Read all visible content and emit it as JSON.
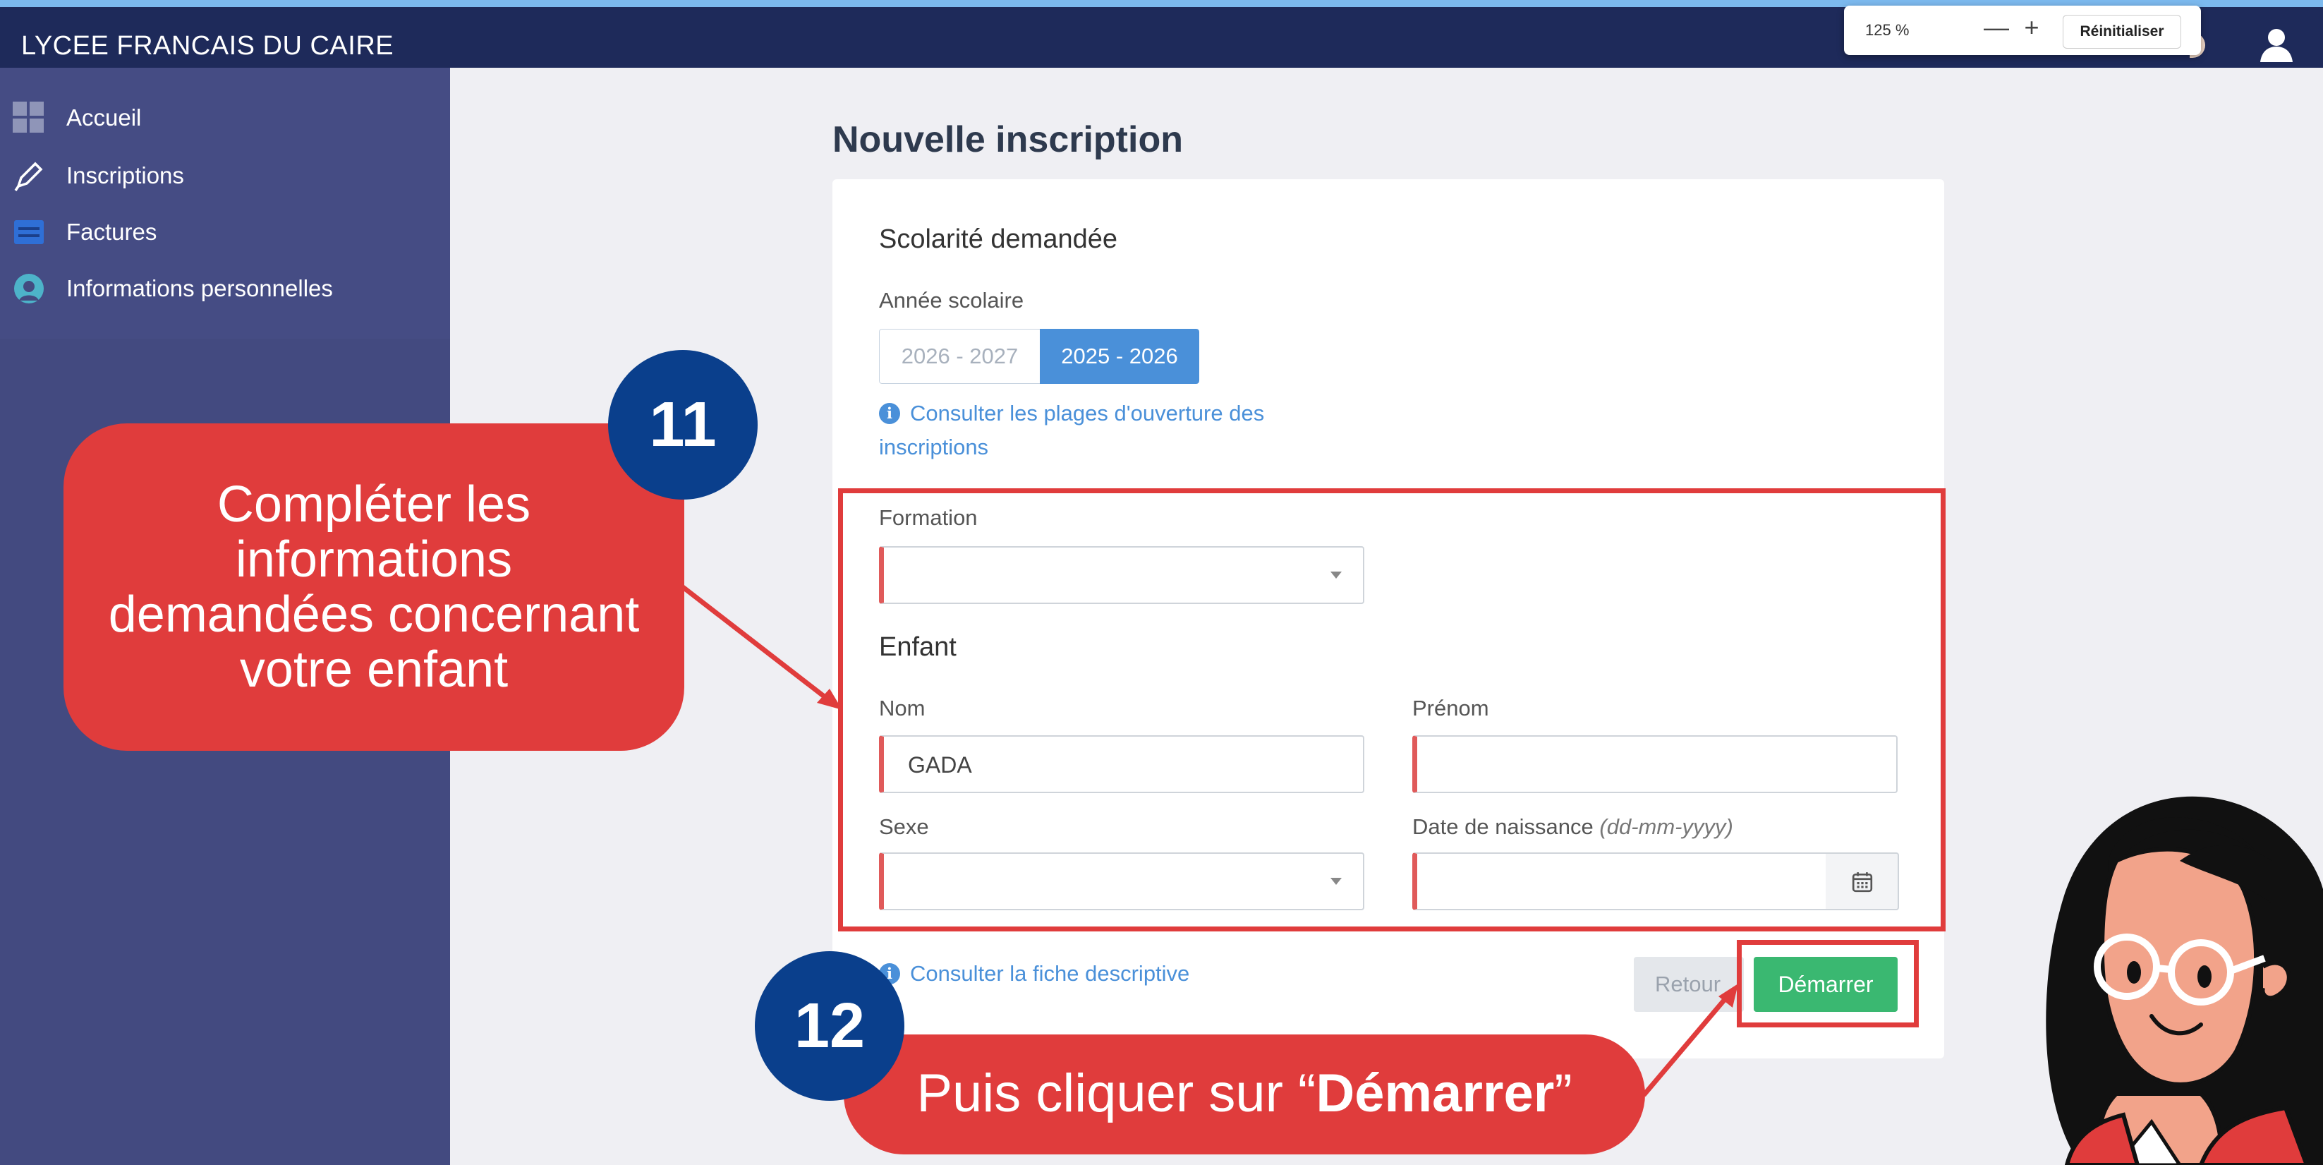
{
  "app": {
    "title": "LYCEE FRANCAIS DU CAIRE"
  },
  "zoom_popup": {
    "level": "125 %",
    "minus": "—",
    "plus": "+",
    "reset": "Réinitialiser"
  },
  "sidebar": {
    "items": [
      {
        "label": "Accueil",
        "icon": "dashboard-grid-icon"
      },
      {
        "label": "Inscriptions",
        "icon": "pencil-icon"
      },
      {
        "label": "Factures",
        "icon": "invoice-icon"
      },
      {
        "label": "Informations personnelles",
        "icon": "user-circle-icon"
      }
    ]
  },
  "page": {
    "title": "Nouvelle inscription"
  },
  "form": {
    "scolarite_title": "Scolarité demandée",
    "annee_label": "Année scolaire",
    "annee_options": [
      "2026 - 2027",
      "2025 - 2026"
    ],
    "annee_selected": "2025 - 2026",
    "plages_link_line1": "Consulter les plages d'ouverture des",
    "plages_link_line2": "inscriptions",
    "formation_label": "Formation",
    "formation_value": "",
    "enfant_title": "Enfant",
    "nom_label": "Nom",
    "nom_value": "GADA",
    "prenom_label": "Prénom",
    "prenom_value": "",
    "sexe_label": "Sexe",
    "sexe_value": "",
    "naissance_label": "Date de naissance ",
    "naissance_hint": "(dd-mm-yyyy)",
    "naissance_value": "",
    "fiche_link": "Consulter la fiche descriptive",
    "retour_label": "Retour",
    "demarrer_label": "Démarrer"
  },
  "annotations": {
    "step11_number": "11",
    "step11_line1": "Compléter les",
    "step11_line2": "informations",
    "step11_line3": "demandées concernant",
    "step11_line4": "votre enfant",
    "step12_number": "12",
    "step12_prefix": "Puis cliquer sur “",
    "step12_bold": "Démarrer",
    "step12_suffix": "”"
  },
  "colors": {
    "topbar": "#1e2a5a",
    "sidebar": "#434a80",
    "accent_blue": "#4a90d9",
    "success_green": "#3ab871",
    "highlight_red": "#e03c3c",
    "step_circle": "#0a3f8c"
  }
}
